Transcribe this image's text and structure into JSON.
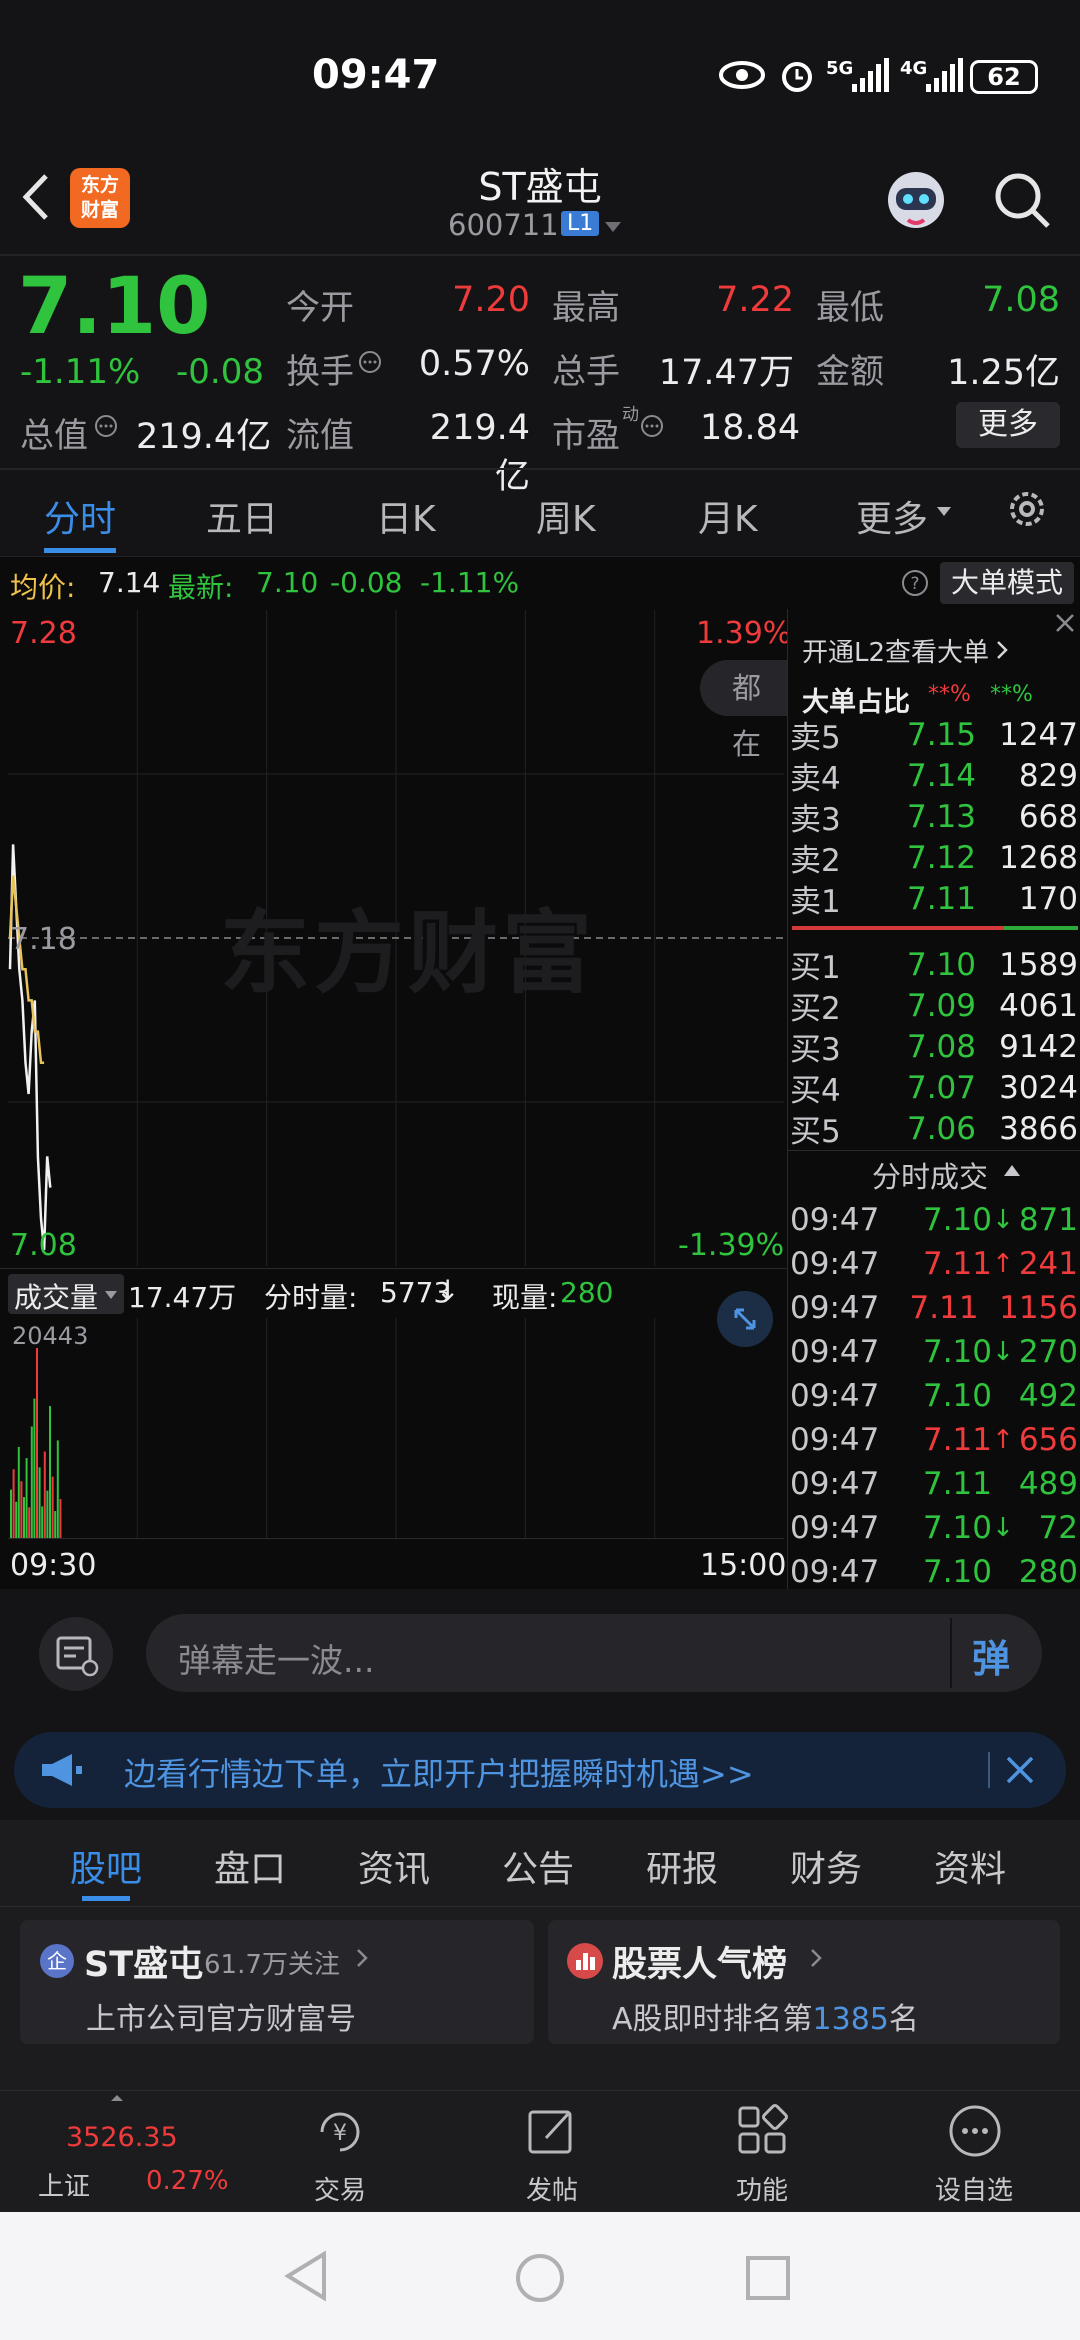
{
  "status_bar": {
    "time": "09:47",
    "battery": "62",
    "network1": "5G",
    "network2": "4G"
  },
  "header": {
    "logo_text_line1": "东方",
    "logo_text_line2": "财富",
    "stock_name": "ST盛屯",
    "stock_code": "600711",
    "level_badge": "L1"
  },
  "quote": {
    "price": "7.10",
    "change_pct": "-1.11%",
    "change": "-0.08",
    "open_label": "今开",
    "open": "7.20",
    "high_label": "最高",
    "high": "7.22",
    "low_label": "最低",
    "low": "7.08",
    "turnover_label": "换手",
    "turnover": "0.57%",
    "volume_label": "总手",
    "volume": "17.47万",
    "amount_label": "金额",
    "amount": "1.25亿",
    "mcap_label": "总值",
    "mcap": "219.4亿",
    "float_label": "流值",
    "float": "219.4亿",
    "pe_label": "市盈",
    "pe_sup": "动",
    "pe": "18.84",
    "more_button": "更多"
  },
  "period_tabs": [
    "分时",
    "五日",
    "日K",
    "周K",
    "月K",
    "更多"
  ],
  "info_line": {
    "avg_label": "均价:",
    "avg": "7.14",
    "latest_label": "最新:",
    "latest": "7.10",
    "change": "-0.08",
    "pct": "-1.11%",
    "mode_button": "大单模式"
  },
  "chart": {
    "y_top": "7.28",
    "y_bottom": "7.08",
    "y_mid": "7.18",
    "pct_top": "1.39%",
    "pct_bottom": "-1.39%",
    "watermark": "东方财富",
    "side_tag": "都在",
    "vol_label": "成交量",
    "vol_total": "17.47万",
    "minute_vol_label": "分时量:",
    "minute_vol": "5773",
    "current_label": "现量:",
    "current": "280",
    "vol_max": "20443",
    "time_start": "09:30",
    "time_end": "15:00"
  },
  "chart_data": {
    "type": "line",
    "x_start": "09:30",
    "x_end": "15:00",
    "ylim": [
      7.08,
      7.28
    ],
    "series": [
      {
        "values": [
          7.17,
          7.21,
          7.19,
          7.17,
          7.16,
          7.14,
          7.13,
          7.15,
          7.16,
          7.11,
          7.09,
          7.08,
          7.11,
          7.1
        ]
      },
      {
        "values": [
          7.18,
          7.2,
          7.19,
          7.18,
          7.17,
          7.17,
          7.16,
          7.16,
          7.15,
          7.15,
          7.14,
          7.14
        ]
      }
    ],
    "volume": [
      5200,
      7400,
      3900,
      9800,
      6100,
      4400,
      8600,
      3300,
      12000,
      15000,
      20443,
      7600,
      3400,
      9300,
      5100,
      14200,
      6600,
      2900,
      10500,
      4200
    ]
  },
  "orderbook": {
    "promo": "开通L2查看大单",
    "ratio_label": "大单占比",
    "ratio_sell": "**%",
    "ratio_buy": "**%",
    "asks": [
      {
        "label": "卖5",
        "price": "7.15",
        "vol": "1247"
      },
      {
        "label": "卖4",
        "price": "7.14",
        "vol": "829"
      },
      {
        "label": "卖3",
        "price": "7.13",
        "vol": "668"
      },
      {
        "label": "卖2",
        "price": "7.12",
        "vol": "1268"
      },
      {
        "label": "卖1",
        "price": "7.11",
        "vol": "170"
      }
    ],
    "bids": [
      {
        "label": "买1",
        "price": "7.10",
        "vol": "1589"
      },
      {
        "label": "买2",
        "price": "7.09",
        "vol": "4061"
      },
      {
        "label": "买3",
        "price": "7.08",
        "vol": "9142"
      },
      {
        "label": "买4",
        "price": "7.07",
        "vol": "3024"
      },
      {
        "label": "买5",
        "price": "7.06",
        "vol": "3866"
      }
    ]
  },
  "trades": {
    "title": "分时成交",
    "rows": [
      {
        "time": "09:47",
        "price": "7.10",
        "arrow": "↓",
        "vol": "871",
        "dir": "down"
      },
      {
        "time": "09:47",
        "price": "7.11",
        "arrow": "↑",
        "vol": "241",
        "dir": "up"
      },
      {
        "time": "09:47",
        "price": "7.11",
        "arrow": "",
        "vol": "1156",
        "dir": "up"
      },
      {
        "time": "09:47",
        "price": "7.10",
        "arrow": "↓",
        "vol": "270",
        "dir": "down"
      },
      {
        "time": "09:47",
        "price": "7.10",
        "arrow": "",
        "vol": "492",
        "dir": "down"
      },
      {
        "time": "09:47",
        "price": "7.11",
        "arrow": "↑",
        "vol": "656",
        "dir": "up"
      },
      {
        "time": "09:47",
        "price": "7.11",
        "arrow": "",
        "vol": "489",
        "dir": "down"
      },
      {
        "time": "09:47",
        "price": "7.10",
        "arrow": "↓",
        "vol": "72",
        "dir": "down"
      },
      {
        "time": "09:47",
        "price": "7.10",
        "arrow": "",
        "vol": "280",
        "dir": "down"
      }
    ]
  },
  "danmu": {
    "placeholder": "弹幕走一波...",
    "send_label": "弹"
  },
  "banner": {
    "text": "边看行情边下单，立即开户把握瞬时机遇>>"
  },
  "bottom_tabs": [
    "股吧",
    "盘口",
    "资讯",
    "公告",
    "研报",
    "财务",
    "资料"
  ],
  "cards": [
    {
      "badge": "企",
      "title": "ST盛屯",
      "sub": "61.7万关注",
      "desc": "上市公司官方财富号"
    },
    {
      "title": "股票人气榜",
      "desc_prefix": "A股即时排名第",
      "rank": "1385",
      "desc_suffix": "名"
    }
  ],
  "nav": {
    "index_value": "3526.35",
    "index_name": "上证",
    "index_pct": "0.27%",
    "items": [
      "交易",
      "发帖",
      "功能",
      "设自选"
    ]
  }
}
